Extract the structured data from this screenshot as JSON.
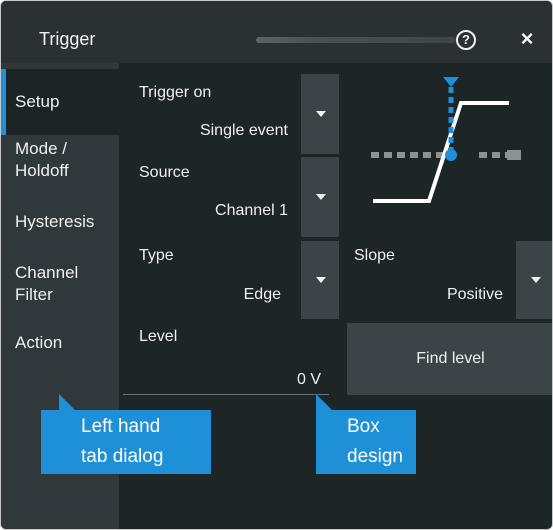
{
  "dialog": {
    "title": "Trigger",
    "help_label": "?",
    "close_label": "×"
  },
  "tabs": [
    {
      "lines": [
        "Setup"
      ],
      "active": true
    },
    {
      "lines": [
        "Mode /",
        "Holdoff"
      ],
      "active": false
    },
    {
      "lines": [
        "Hysteresis"
      ],
      "active": false
    },
    {
      "lines": [
        "Channel",
        "Filter"
      ],
      "active": false
    },
    {
      "lines": [
        "Action"
      ],
      "active": false
    }
  ],
  "setup": {
    "trigger_on": {
      "label": "Trigger on",
      "value": "Single event"
    },
    "source": {
      "label": "Source",
      "value": "Channel 1"
    },
    "type": {
      "label": "Type",
      "value": "Edge"
    },
    "slope": {
      "label": "Slope",
      "value": "Positive"
    },
    "level": {
      "label": "Level",
      "value": "0 V"
    },
    "find_level_label": "Find level"
  },
  "callouts": {
    "left": [
      "Left hand",
      "tab dialog"
    ],
    "right": [
      "Box",
      "design"
    ]
  },
  "icons": {
    "trigger_graphic": "positive-edge-trigger-icon",
    "help": "help-icon",
    "close": "close-icon",
    "dropdown": "chevron-down-icon"
  },
  "colors": {
    "accent": "#1e90d8",
    "callout_bg": "#1e90d8",
    "panel_bg": "#1e2527",
    "tab_bg": "#30383b"
  }
}
